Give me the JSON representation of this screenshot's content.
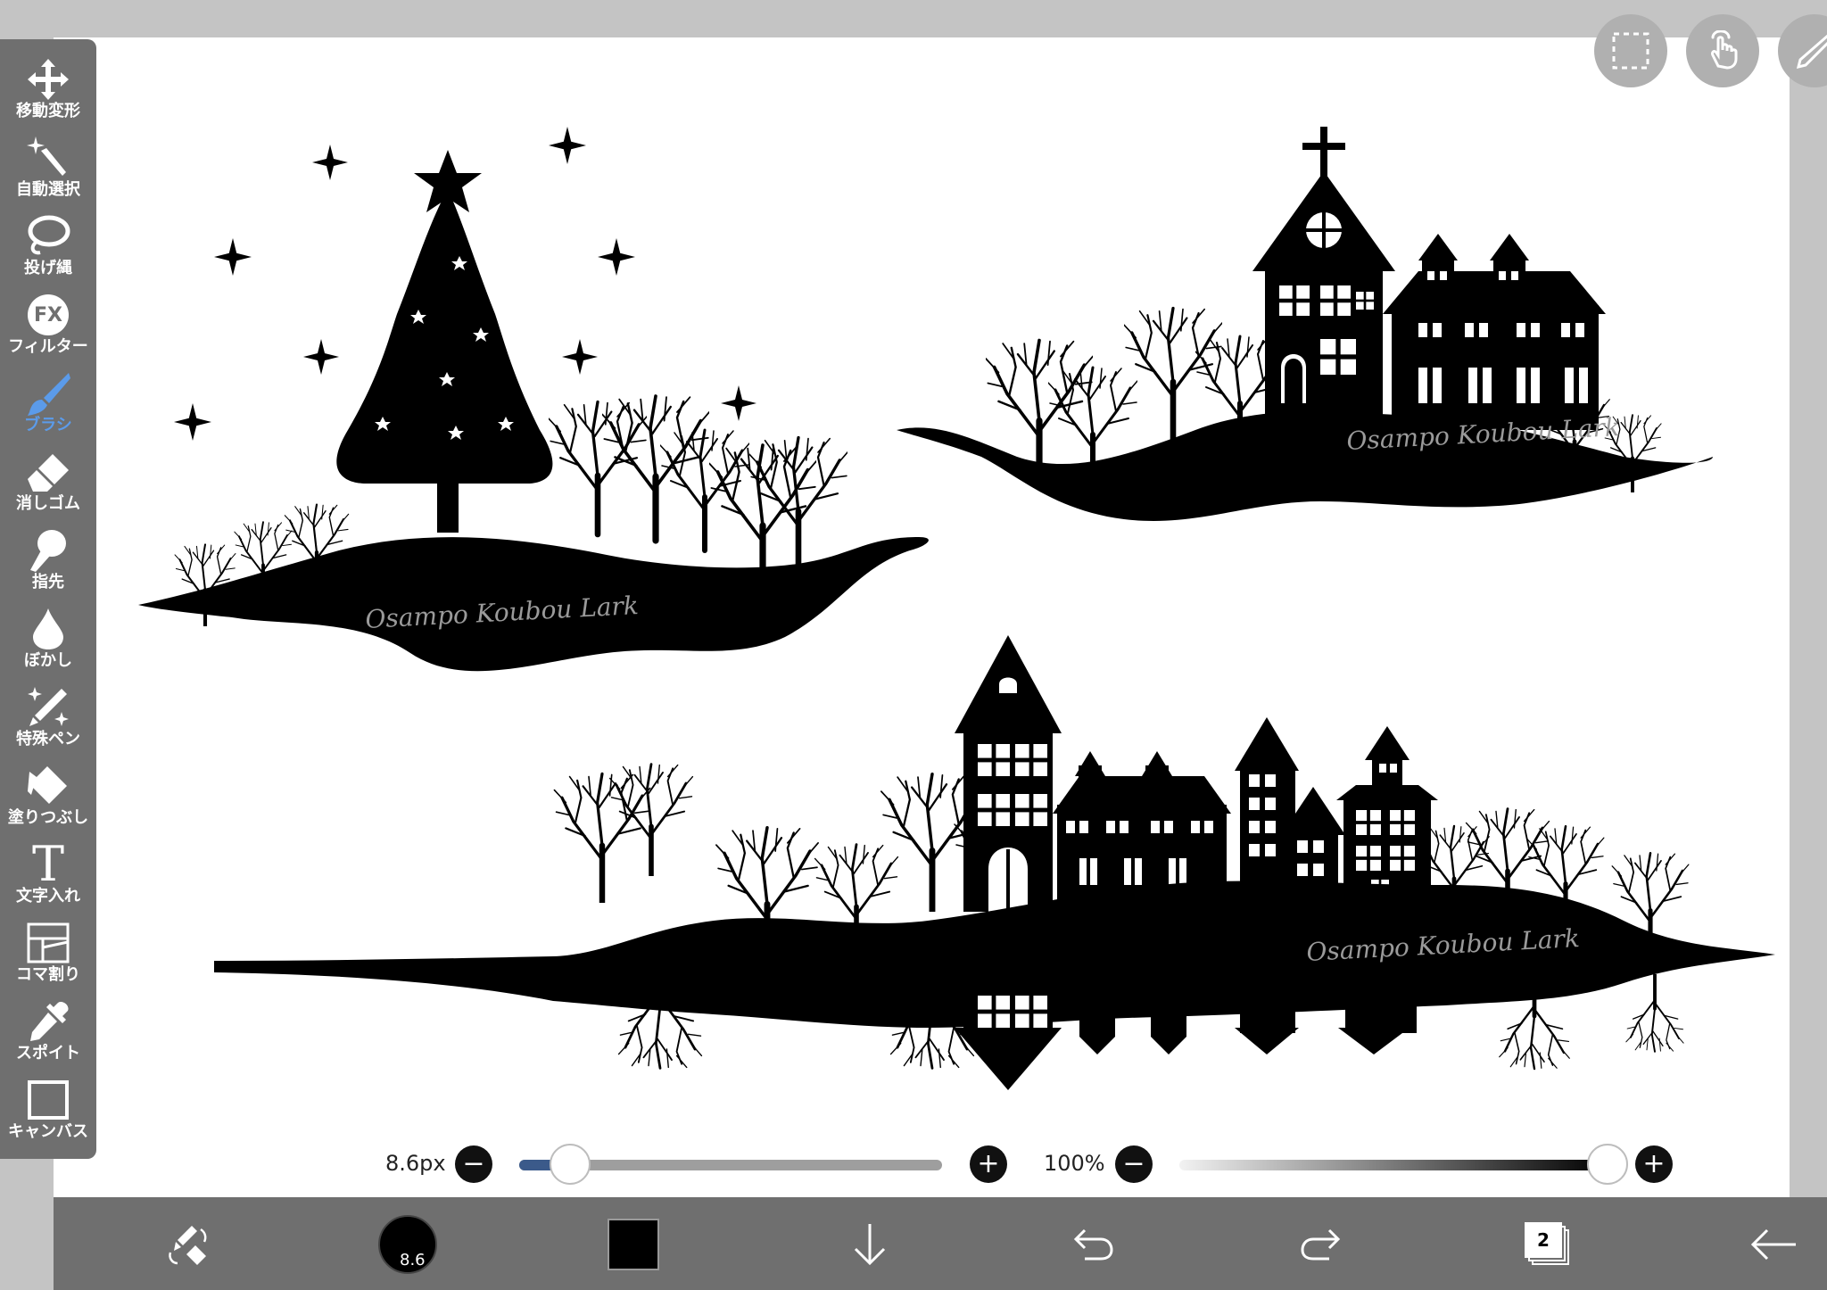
{
  "tools": [
    {
      "label": "移動変形",
      "icon": "move-arrows-icon",
      "active": false
    },
    {
      "label": "自動選択",
      "icon": "magic-wand-icon",
      "active": false
    },
    {
      "label": "投げ縄",
      "icon": "lasso-icon",
      "active": false
    },
    {
      "label": "フィルター",
      "icon": "fx-filter-icon",
      "active": false,
      "icon_text": "FX"
    },
    {
      "label": "ブラシ",
      "icon": "brush-icon",
      "active": true
    },
    {
      "label": "消しゴム",
      "icon": "eraser-icon",
      "active": false
    },
    {
      "label": "指先",
      "icon": "finger-smudge-icon",
      "active": false
    },
    {
      "label": "ぼかし",
      "icon": "blur-drop-icon",
      "active": false
    },
    {
      "label": "特殊ペン",
      "icon": "special-pen-icon",
      "active": false
    },
    {
      "label": "塗りつぶし",
      "icon": "fill-bucket-icon",
      "active": false
    },
    {
      "label": "文字入れ",
      "icon": "text-icon",
      "active": false,
      "icon_text": "T"
    },
    {
      "label": "コマ割り",
      "icon": "panel-divide-icon",
      "active": false
    },
    {
      "label": "スポイト",
      "icon": "eyedropper-icon",
      "active": false
    },
    {
      "label": "キャンバス",
      "icon": "canvas-icon",
      "active": false
    }
  ],
  "brush_size": {
    "label": "8.6px",
    "value_fraction": 0.12
  },
  "opacity": {
    "label": "100%",
    "value_fraction": 1.0
  },
  "bottom": {
    "brush_preview_label": "8.6",
    "color_hex": "#000000",
    "layer_count": "2"
  },
  "accent_color": "#5b9bea",
  "artwork": {
    "signature": "Osampo Koubou Lark"
  }
}
